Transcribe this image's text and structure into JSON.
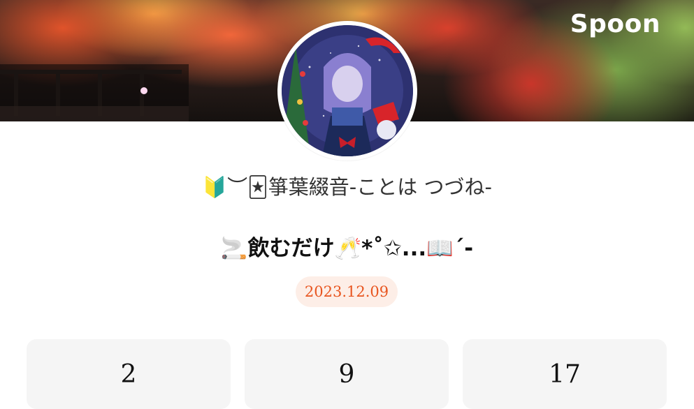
{
  "brand": {
    "logo_text": "Spoon"
  },
  "profile": {
    "nickname": "🔰︶🃏箏葉綴音-ことは つづね-",
    "title": "🚬飲むだけ🥂*˚✩...📖´-",
    "date": "2023.12.09"
  },
  "stats": [
    {
      "value": "2"
    },
    {
      "value": "9"
    },
    {
      "value": "17"
    }
  ],
  "colors": {
    "accent": "#e8551f",
    "badge_bg": "#fdeee7",
    "card_bg": "#f5f5f5"
  }
}
